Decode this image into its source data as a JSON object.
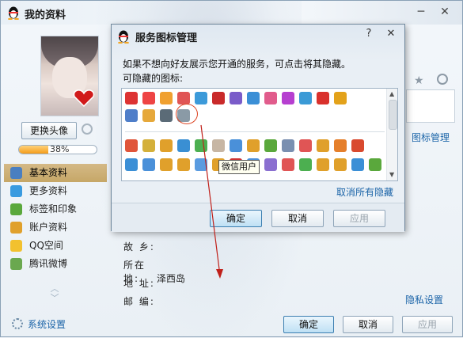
{
  "window": {
    "title": "我的资料",
    "minimize": "─",
    "close": "✕",
    "change_avatar": "更换头像",
    "progress_label": "38%",
    "progress_value": 0.38
  },
  "sidebar": {
    "items": [
      {
        "label": "基本资料",
        "icon": "id-card-icon",
        "color": "#4a7fc0"
      },
      {
        "label": "更多资料",
        "icon": "notebook-icon",
        "color": "#3a9be0"
      },
      {
        "label": "标签和印象",
        "icon": "tag-icon",
        "color": "#5aa83c"
      },
      {
        "label": "账户资料",
        "icon": "account-icon",
        "color": "#e0a02b"
      },
      {
        "label": "QQ空间",
        "icon": "star-icon",
        "color": "#f2c12e"
      },
      {
        "label": "腾讯微博",
        "icon": "weibo-icon",
        "color": "#6aa84f"
      }
    ],
    "settings_label": "系统设置"
  },
  "profile": {
    "hometown_label": "故  乡:",
    "hometown_value": "",
    "location_label": "所在地:",
    "location_value": "泽西岛",
    "address_label": "地  址:",
    "address_value": "",
    "zip_label": "邮  编:",
    "zip_value": ""
  },
  "links": {
    "icon_manage": "图标管理",
    "privacy": "隐私设置"
  },
  "footer": {
    "ok": "确定",
    "cancel": "取消",
    "apply": "应用"
  },
  "dialog": {
    "title": "服务图标管理",
    "help": "?",
    "close": "✕",
    "description": "如果不想向好友展示您开通的服务，可点击将其隐藏。",
    "hidden_label": "可隐藏的图标:",
    "tooltip": "微信用户",
    "unhide_all": "取消所有隐藏",
    "ok": "确定",
    "cancel": "取消",
    "apply": "应用",
    "row1_colors": [
      "#d33",
      "#e44",
      "#f0a030",
      "#e05555",
      "#3c9ad9",
      "#c92a2a",
      "#7a5cc9",
      "#3b8fd6",
      "#e15c8c",
      "#b63fd0",
      "#3b9ad6",
      "#d9312c",
      "#e3a21a"
    ],
    "row2_colors": [
      "#4f7ec9",
      "#e6a83a",
      "#5b6b77",
      "#8a9aa6"
    ],
    "row3_colors": [
      "#e0553a",
      "#d4b03a",
      "#e0a02b",
      "#3a8fd3",
      "#4caf50",
      "#c7b6a4",
      "#4a90d9",
      "#e0a02b",
      "#5aa83c",
      "#7a8fb0",
      "#e05555",
      "#e0a02b",
      "#e57f2b",
      "#d94a2f"
    ],
    "row4_colors": [
      "#3b8fd6",
      "#4a90d9",
      "#e0a02b",
      "#e0a02b",
      "#5a9be0",
      "#e0a02b",
      "#c33",
      "#4a90d9",
      "#8a6fd0",
      "#e05555",
      "#4caf50",
      "#e0a02b",
      "#e0a02b",
      "#3b8fd6",
      "#5aa83c"
    ]
  }
}
